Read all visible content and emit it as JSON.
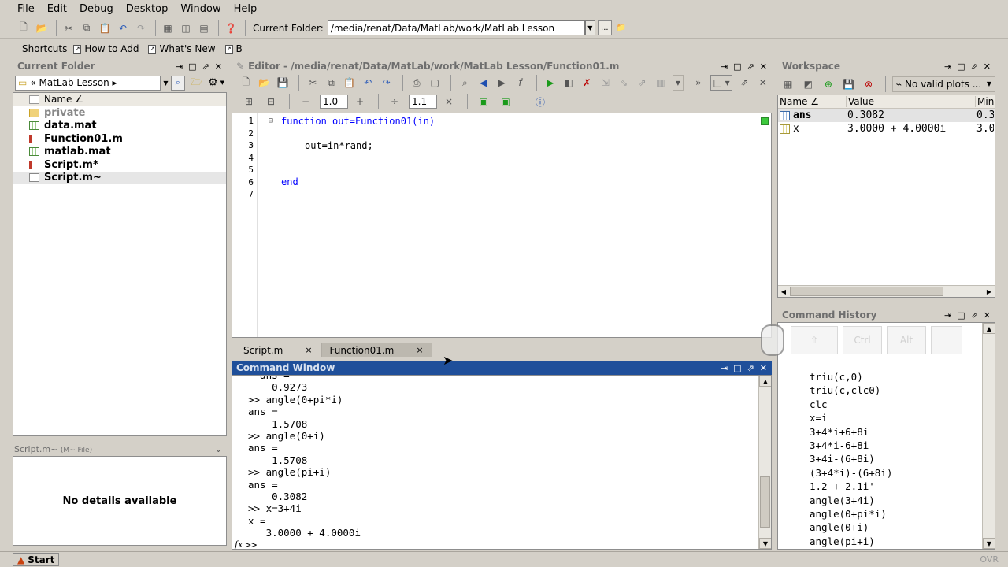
{
  "menu": [
    "File",
    "Edit",
    "Debug",
    "Desktop",
    "Window",
    "Help"
  ],
  "toolbar": {
    "current_folder_label": "Current Folder:",
    "current_folder_path": "/media/renat/Data/MatLab/work/MatLab Lesson",
    "browse_label": "..."
  },
  "shortcuts": {
    "label": "Shortcuts",
    "items": [
      "How to Add",
      "What's New",
      "B"
    ]
  },
  "current_folder": {
    "title": "Current Folder",
    "breadcrumb": "« MatLab Lesson ▸",
    "column_name": "Name ∠",
    "files": [
      {
        "name": "private",
        "type": "folder",
        "dim": true
      },
      {
        "name": "data.mat",
        "type": "mat"
      },
      {
        "name": "Function01.m",
        "type": "m"
      },
      {
        "name": "matlab.mat",
        "type": "mat"
      },
      {
        "name": "Script.m*",
        "type": "m"
      },
      {
        "name": "Script.m~",
        "type": "doc",
        "selected": true
      }
    ],
    "details_title": "Script.m~",
    "details_subtitle": "(M~ File)",
    "details_text": "No details available"
  },
  "editor": {
    "title": "Editor - /media/renat/Data/MatLab/work/MatLab Lesson/Function01.m",
    "cell_value_1": "1.0",
    "cell_value_2": "1.1",
    "line_numbers": [
      "1",
      "2",
      "3",
      "4",
      "5",
      "6",
      "7"
    ],
    "lines": [
      {
        "text": "function out=Function01(in)",
        "kw": "function",
        "indent": 0
      },
      {
        "text": "",
        "indent": 0
      },
      {
        "text": "out=in*rand;",
        "indent": 1
      },
      {
        "text": "",
        "indent": 0
      },
      {
        "text": "",
        "indent": 0
      },
      {
        "text": "end",
        "kw": "end",
        "indent": 0
      },
      {
        "text": "",
        "indent": 0
      }
    ],
    "tabs": [
      {
        "label": "Script.m",
        "active": false
      },
      {
        "label": "Function01.m",
        "active": true
      }
    ]
  },
  "command_window": {
    "title": "Command Window",
    "lines": [
      "  ans =",
      "    0.9273",
      ">> angle(0+pi*i)",
      "ans =",
      "    1.5708",
      ">> angle(0+i)",
      "ans =",
      "    1.5708",
      ">> angle(pi+i)",
      "ans =",
      "    0.3082",
      ">> x=3+4i",
      "x =",
      "   3.0000 + 4.0000i"
    ],
    "prompt": ">>"
  },
  "workspace": {
    "title": "Workspace",
    "plot_selector": "No valid plots ...",
    "columns": [
      "Name ∠",
      "Value",
      "Min"
    ],
    "rows": [
      {
        "name": "ans",
        "value": "0.3082",
        "min": "0.3"
      },
      {
        "name": "x",
        "value": "3.0000 + 4.0000i",
        "min": "3.0"
      }
    ]
  },
  "command_history": {
    "title": "Command History",
    "overlay_keys": [
      "Ctrl",
      "Alt"
    ],
    "items": [
      "triu(c,0)",
      "triu(c,clc0)",
      "clc",
      "x=i",
      "3+4*i+6+8i",
      "3+4*i-6+8i",
      "3+4i-(6+8i)",
      "(3+4*i)-(6+8i)",
      "1.2 + 2.1i'",
      "angle(3+4i)",
      "angle(0+pi*i)",
      "angle(0+i)",
      "angle(pi+i)",
      "x=3+4i"
    ]
  },
  "status": {
    "start_label": "Start",
    "ovr": "OVR"
  },
  "colors": {
    "active_title": "#1f4f9a",
    "keyword": "#0000ff",
    "chrome": "#d4d0c8"
  }
}
